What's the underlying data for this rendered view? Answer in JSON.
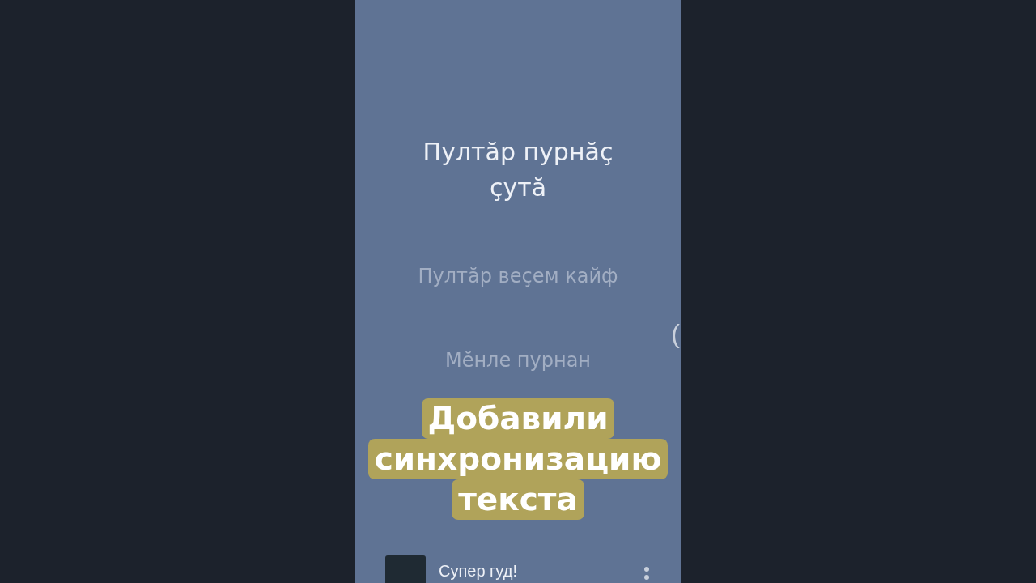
{
  "lyrics": [
    {
      "text": "Пултăр пурнăç çутă",
      "active": true
    },
    {
      "text": "Пултăр веçем кайф",
      "active": false
    },
    {
      "text": "Мĕнле пурнан",
      "active": false
    }
  ],
  "edge_glyph": "(",
  "caption": {
    "lines": [
      "Добавили",
      "синхронизацию",
      "текста"
    ]
  },
  "mini_player": {
    "title": "Супер гуд!"
  }
}
